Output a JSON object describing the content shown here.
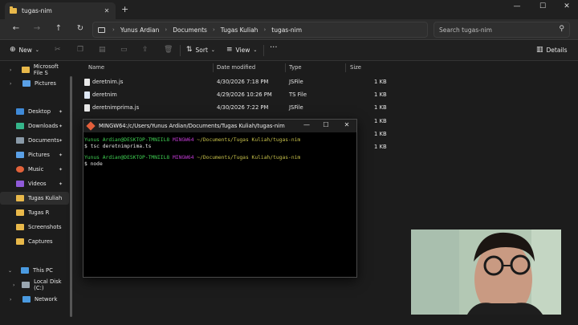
{
  "colors": {
    "accent": "#e8b84a",
    "terminal_user": "#3fcf52",
    "terminal_host": "#c23bd4",
    "terminal_path": "#c7c14a"
  },
  "explorer": {
    "tab_title": "tugas-nim",
    "new_tab": "+",
    "window_controls": {
      "minimize": "—",
      "maximize": "☐",
      "close": "✕"
    },
    "breadcrumbs": [
      "Yunus Ardian",
      "Documents",
      "Tugas Kuliah",
      "tugas-nim"
    ],
    "search_placeholder": "Search tugas-nim",
    "toolbar": {
      "new_label": "New",
      "sort_label": "Sort",
      "view_label": "View",
      "more": "···",
      "details_label": "Details"
    },
    "sidebar": {
      "items": [
        {
          "label": "Microsoft File S",
          "icon": "folder-icon"
        },
        {
          "label": "Pictures",
          "icon": "pictures-icon"
        },
        {
          "label": "Desktop",
          "icon": "desktop-icon",
          "pinned": "✦"
        },
        {
          "label": "Downloads",
          "icon": "downloads-icon",
          "pinned": "✦"
        },
        {
          "label": "Documents",
          "icon": "documents-icon",
          "pinned": "✦"
        },
        {
          "label": "Pictures",
          "icon": "pictures-icon",
          "pinned": "✦"
        },
        {
          "label": "Music",
          "icon": "music-icon",
          "pinned": "✦"
        },
        {
          "label": "Videos",
          "icon": "videos-icon",
          "pinned": "✦"
        },
        {
          "label": "Tugas Kuliah",
          "icon": "folder-icon"
        },
        {
          "label": "Tugas R",
          "icon": "folder-icon"
        },
        {
          "label": "Screenshots",
          "icon": "folder-icon"
        },
        {
          "label": "Captures",
          "icon": "folder-icon"
        },
        {
          "label": "This PC",
          "icon": "this-pc-icon"
        },
        {
          "label": "Local Disk (C:)",
          "icon": "drive-icon"
        },
        {
          "label": "Network",
          "icon": "network-icon"
        }
      ]
    },
    "columns": {
      "name": "Name",
      "date": "Date modified",
      "type": "Type",
      "size": "Size"
    },
    "files": [
      {
        "name": "deretnim.js",
        "date": "4/30/2026 7:18 PM",
        "type": "JSFile",
        "size": "1 KB"
      },
      {
        "name": "deretnim",
        "date": "4/29/2026 10:26 PM",
        "type": "TS File",
        "size": "1 KB"
      },
      {
        "name": "deretnimprima.js",
        "date": "4/30/2026 7:22 PM",
        "type": "JSFile",
        "size": "1 KB"
      },
      {
        "size": "1 KB"
      },
      {
        "size": "1 KB"
      },
      {
        "size": "1 KB"
      }
    ]
  },
  "terminal": {
    "title": "MINGW64:/c/Users/Yunus Ardian/Documents/Tugas Kuliah/tugas-nim",
    "controls": {
      "minimize": "—",
      "maximize": "☐",
      "close": "✕"
    },
    "prompt_user": "Yunus Ardian@DESKTOP-TMNIIL8",
    "prompt_env": "MINGW64",
    "prompt_path": "~/Documents/Tugas Kuliah/tugas-nim",
    "cmd1": "$ tsc deretnimprima.ts",
    "cmd2": "$ node"
  }
}
